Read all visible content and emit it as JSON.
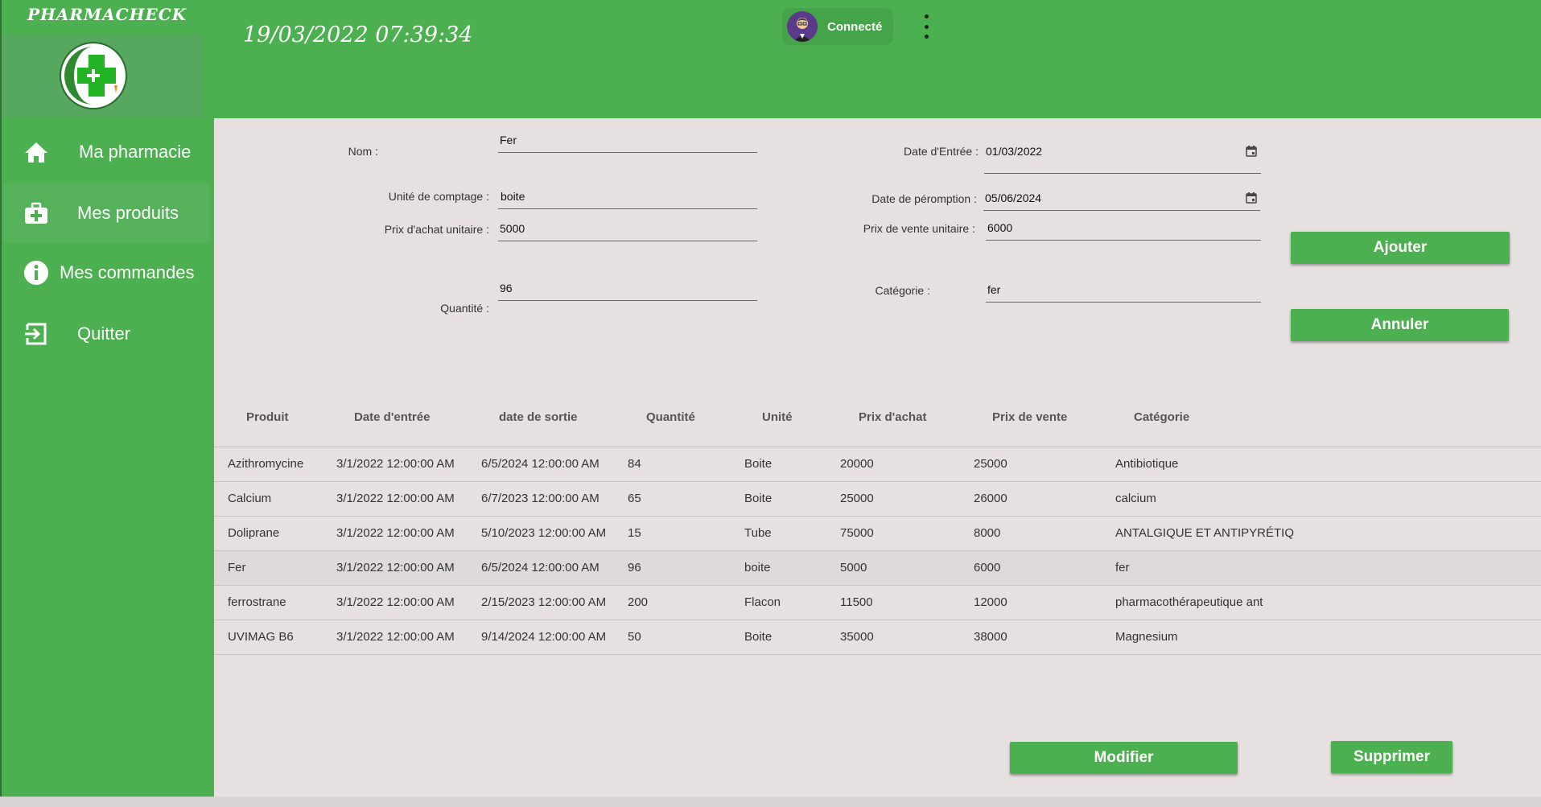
{
  "app": {
    "brand": "PHARMACHECK"
  },
  "header": {
    "datetime": "19/03/2022 07:39:34",
    "user_status": "Connecté"
  },
  "nav": [
    {
      "label": "Ma pharmacie",
      "icon": "home-icon"
    },
    {
      "label": "Mes produits",
      "icon": "medical-bag-icon"
    },
    {
      "label": "Mes commandes",
      "icon": "info-icon"
    },
    {
      "label": "Quitter",
      "icon": "exit-icon"
    }
  ],
  "form": {
    "nom_label": "Nom :",
    "nom": "Fer",
    "unite_label": "Unité de comptage :",
    "unite": "boite",
    "prix_achat_label": "Prix d'achat unitaire :",
    "prix_achat": "5000",
    "quantite_label": "Quantité :",
    "quantite": "96",
    "date_entree_label": "Date d'Entrée :",
    "date_entree": "01/03/2022",
    "date_peremption_label": "Date de péromption :",
    "date_peremption": "05/06/2024",
    "prix_vente_label": "Prix de vente unitaire :",
    "prix_vente": "6000",
    "categorie_label": "Catégorie :",
    "categorie": "fer",
    "ajouter": "Ajouter",
    "annuler": "Annuler"
  },
  "table": {
    "headers": [
      "Produit",
      "Date d'entrée",
      "date de sortie",
      "Quantité",
      "Unité",
      "Prix d'achat",
      "Prix de vente",
      "Catégorie"
    ],
    "rows": [
      [
        "Azithromycine",
        "3/1/2022 12:00:00 AM",
        "6/5/2024 12:00:00 AM",
        "84",
        "Boite",
        "20000",
        "25000",
        "Antibiotique"
      ],
      [
        "Calcium",
        "3/1/2022 12:00:00 AM",
        "6/7/2023 12:00:00 AM",
        "65",
        "Boite",
        "25000",
        "26000",
        "calcium"
      ],
      [
        "Doliprane",
        "3/1/2022 12:00:00 AM",
        "5/10/2023 12:00:00 AM",
        "15",
        "Tube",
        "75000",
        "8000",
        "ANTALGIQUE ET ANTIPYRÉTIQ"
      ],
      [
        "Fer",
        "3/1/2022 12:00:00 AM",
        "6/5/2024 12:00:00 AM",
        "96",
        "boite",
        "5000",
        "6000",
        "fer"
      ],
      [
        "ferrostrane",
        "3/1/2022 12:00:00 AM",
        "2/15/2023 12:00:00 AM",
        "200",
        "Flacon",
        "11500",
        "12000",
        "pharmacothérapeutique ant"
      ],
      [
        "UVIMAG B6",
        "3/1/2022 12:00:00 AM",
        "9/14/2024 12:00:00 AM",
        "50",
        "Boite",
        "35000",
        "38000",
        "Magnesium"
      ]
    ]
  },
  "actions": {
    "modifier": "Modifier",
    "supprimer": "Supprimer"
  },
  "colors": {
    "primary": "#4caf50",
    "background": "#e7e0e0",
    "selected_row": "#dedada"
  }
}
